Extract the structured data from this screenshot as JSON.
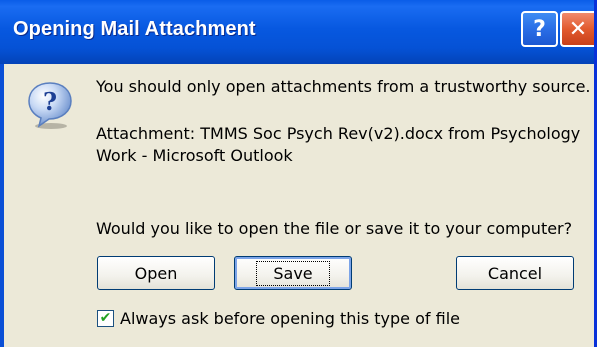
{
  "window": {
    "title": "Opening Mail Attachment",
    "help_glyph": "?",
    "close_glyph": "✕"
  },
  "dialog": {
    "icon": "question-icon",
    "message": "You should only open attachments from a trustworthy source.",
    "attachment_text": "Attachment: TMMS Soc Psych Rev(v2).docx from Psychology Work - Microsoft Outlook",
    "prompt": "Would you like to open the file or save it to your computer?"
  },
  "buttons": {
    "open": "Open",
    "save": "Save",
    "cancel": "Cancel"
  },
  "checkbox": {
    "label": "Always ask before opening this type of file",
    "checked": true,
    "check_glyph": "✔"
  },
  "colors": {
    "titlebar": "#0758e0",
    "dialog_bg": "#ece9d8",
    "check": "#21a121"
  }
}
